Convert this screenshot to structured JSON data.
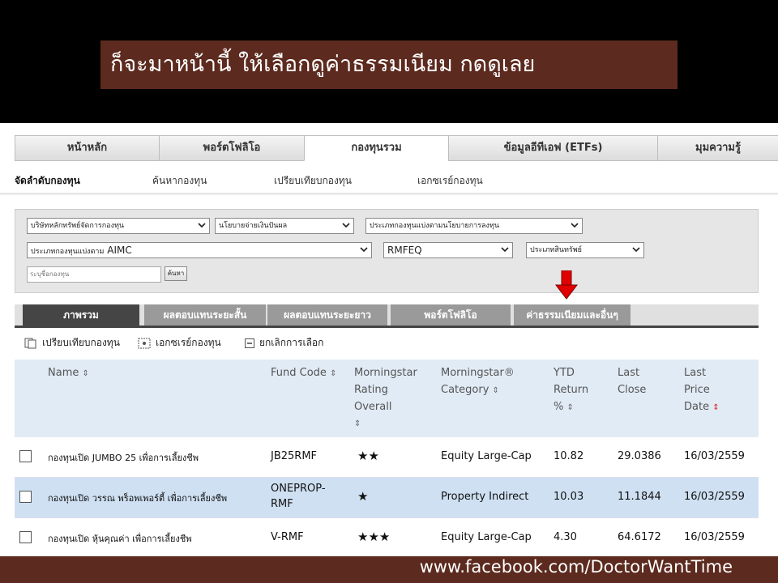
{
  "banner": {
    "text": "ก็จะมาหน้านี้ ให้เลือกดูค่าธรรมเนียม กดดูเลย"
  },
  "nav": {
    "tabs": [
      "หน้าหลัก",
      "พอร์ตโฟลิโอ",
      "กองทุนรวม",
      "ข้อมูลอีทีเอฟ (ETFs)",
      "มุมความรู้"
    ],
    "active_index": 2
  },
  "subnav": {
    "items": [
      "จัดลำดับกองทุน",
      "ค้นหากองทุน",
      "เปรียบเทียบกองทุน",
      "เอกซเรย์กองทุน"
    ]
  },
  "filters": {
    "amc": "บริษัทหลักทรัพย์จัดการกองทุน",
    "policy": "นโยบายจ่ายเงินปันผล",
    "fund_type": "ประเภทกองทุนแบ่งตามนโยบายการลงทุน",
    "aimc_label": "ประเภทกองทุนแบ่งตาม",
    "aimc_value": "AIMC",
    "category": "RMFEQ",
    "asset": "ประเภทสินทรัพย์",
    "search_placeholder": "ระบุชื่อกองทุน",
    "search_button": "ค้นหา"
  },
  "fund_tabs": [
    "ภาพรวม",
    "ผลตอบแทนระยะสั้น",
    "ผลตอบแทนระยะยาว",
    "พอร์ตโฟลิโอ",
    "ค่าธรรมเนียมและอื่นๆ"
  ],
  "actions": {
    "compare": "เปรียบเทียบกองทุน",
    "xray": "เอกซเรย์กองทุน",
    "cancel": "ยกเลิกการเลือก"
  },
  "table": {
    "headers": {
      "name": "Name",
      "code": "Fund Code",
      "rating_1": "Morningstar",
      "rating_2": "Rating",
      "rating_3": "Overall",
      "category_1": "Morningstar®",
      "category_2": "Category",
      "ytd_1": "YTD",
      "ytd_2": "Return",
      "ytd_3": "%",
      "close_1": "Last",
      "close_2": "Close",
      "date_1": "Last",
      "date_2": "Price",
      "date_3": "Date"
    },
    "sort_glyph": "⇕",
    "sort_desc_glyph": "⇕",
    "rows": [
      {
        "name": "กองทุนเปิด JUMBO 25 เพื่อการเลี้ยงชีพ",
        "code": "JB25RMF",
        "stars": "★★",
        "category": "Equity Large-Cap",
        "ytd": "10.82",
        "close": "29.0386",
        "date": "16/03/2559"
      },
      {
        "name": "กองทุนเปิด วรรณ พร็อพเพอร์ตี้ เพื่อการเลี้ยงชีพ",
        "code_1": "ONEPROP-",
        "code_2": "RMF",
        "stars": "★",
        "category": "Property Indirect",
        "ytd": "10.03",
        "close": "11.1844",
        "date": "16/03/2559"
      },
      {
        "name": "กองทุนเปิด หุ้นคุณค่า เพื่อการเลี้ยงชีพ",
        "code": "V-RMF",
        "stars": "★★★",
        "category": "Equity Large-Cap",
        "ytd": "4.30",
        "close": "64.6172",
        "date": "16/03/2559"
      }
    ]
  },
  "footer": {
    "text": "www.facebook.com/DoctorWantTime"
  },
  "colors": {
    "banner_bg": "#5c2a1e",
    "header_bg": "#e1ebf5",
    "alt_row": "#cfe0f3",
    "arrow": "#e00000"
  }
}
